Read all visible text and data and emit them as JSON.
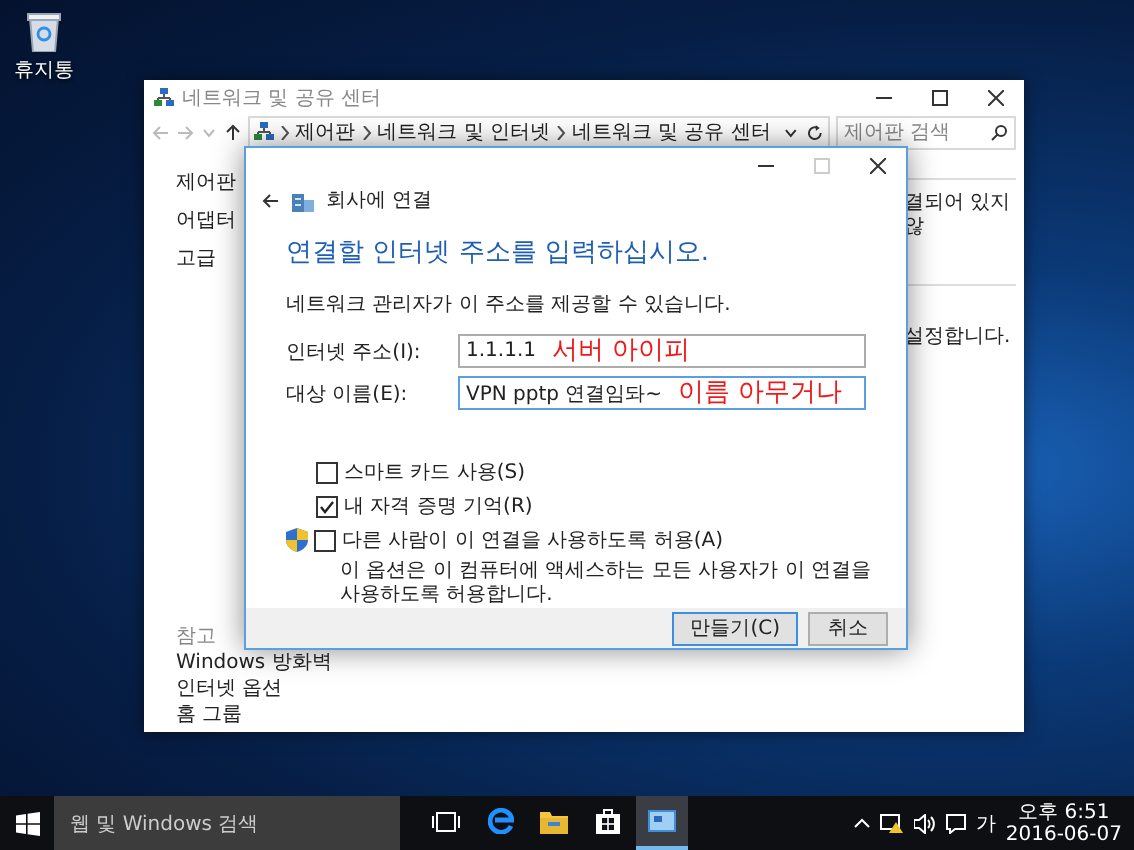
{
  "desktop_icons": [
    {
      "label": "휴지통"
    }
  ],
  "back_window": {
    "title": "네트워크 및 공유 센터",
    "breadcrumbs": [
      "제어판",
      "네트워크 및 인터넷",
      "네트워크 및 공유 센터"
    ],
    "search": {
      "placeholder": "제어판 검색"
    },
    "sidebar_top": [
      "제어판",
      "어댑터",
      "고급"
    ],
    "content_texts": [
      "결되어 있지 않",
      "설정합니다."
    ],
    "see_also": [
      "참고",
      "Windows 방화벽",
      "인터넷 옵션",
      "홈 그룹"
    ]
  },
  "dialog": {
    "title": "회사에 연결",
    "heading": "연결할 인터넷 주소를 입력하십시오.",
    "description": "네트워크 관리자가 이 주소를 제공할 수 있습니다.",
    "fields": [
      {
        "label": "인터넷 주소(I):",
        "value": "1.1.1.1",
        "annotation": "서버 아이피",
        "focused": false
      },
      {
        "label": "대상 이름(E):",
        "value": "VPN pptp 연결임돠~",
        "annotation": "이름 아무거나",
        "focused": true
      }
    ],
    "options": [
      {
        "label": "스마트 카드 사용(S)",
        "checked": false,
        "shield": false
      },
      {
        "label": "내 자격 증명 기억(R)",
        "checked": true,
        "shield": false
      },
      {
        "label": "다른 사람이 이 연결을 사용하도록 허용(A)",
        "checked": false,
        "shield": true,
        "note": "이 옵션은 이 컴퓨터에 액세스하는 모든 사용자가 이 연결을 사용하도록 허용합니다."
      }
    ],
    "buttons": [
      {
        "label": "만들기(C)",
        "default": true
      },
      {
        "label": "취소",
        "default": false
      }
    ]
  },
  "taskbar": {
    "search_placeholder": "웹 및 Windows 검색",
    "apps": [
      {
        "kind": "task-view",
        "active": false
      },
      {
        "kind": "browser",
        "active": false
      },
      {
        "kind": "folder",
        "active": false
      },
      {
        "kind": "store",
        "active": false
      },
      {
        "kind": "network",
        "active": true
      }
    ],
    "ime": "가",
    "time": "오후 6:51",
    "date": "2016-06-07"
  }
}
